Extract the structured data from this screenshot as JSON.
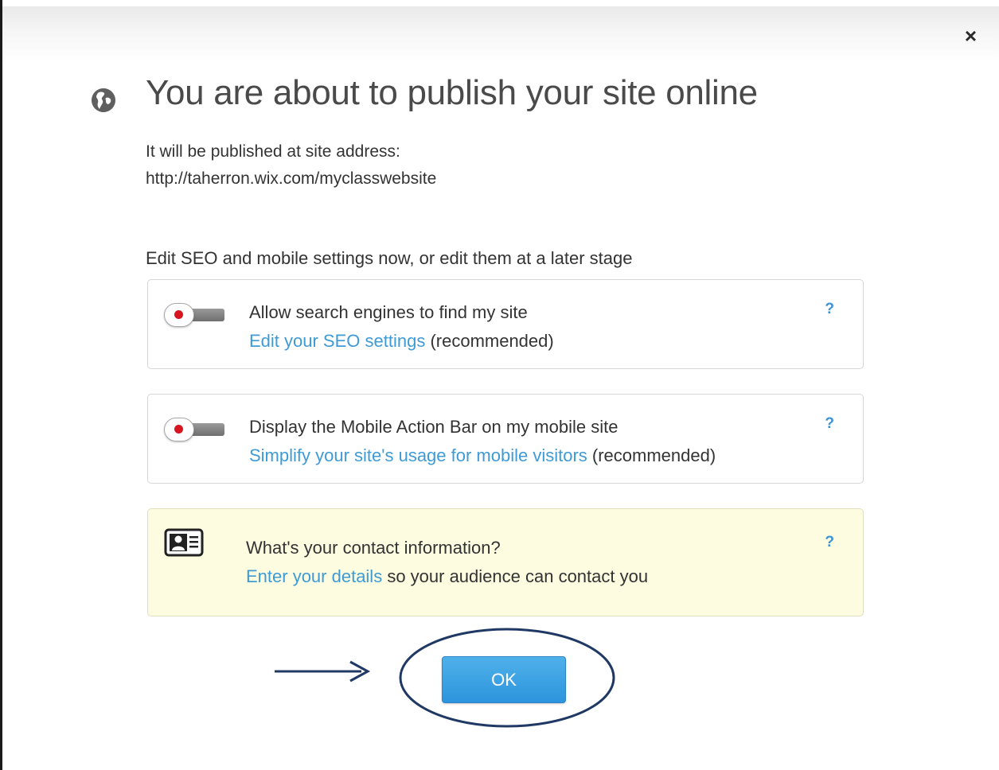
{
  "dialog": {
    "close_glyph": "×",
    "title": "You are about to publish your site online",
    "address_intro": "It will be published at site address:",
    "address_url": "http://taherron.wix.com/myclasswebsite",
    "settings_intro": "Edit SEO and mobile settings now, or edit them at a later stage",
    "globe_icon": "globe-icon"
  },
  "cards": [
    {
      "title": "Allow search engines to find my site",
      "link": "Edit your SEO settings",
      "suffix": " (recommended)",
      "help": "?",
      "toggle_on": false
    },
    {
      "title": "Display the Mobile Action Bar on my mobile site",
      "link": "Simplify your site's usage for mobile visitors",
      "suffix": " (recommended)",
      "help": "?",
      "toggle_on": false
    },
    {
      "title": "What's your contact information?",
      "link": "Enter your details",
      "suffix": " so your audience can contact you",
      "help": "?",
      "icon": "contact-card-icon"
    }
  ],
  "footer": {
    "ok_label": "OK"
  },
  "colors": {
    "link": "#3e9bd6",
    "button": "#3ba3e4",
    "toggle_dot": "#d7141f",
    "contact_card_bg": "#fdfbe0",
    "annotation": "#1f3864"
  }
}
